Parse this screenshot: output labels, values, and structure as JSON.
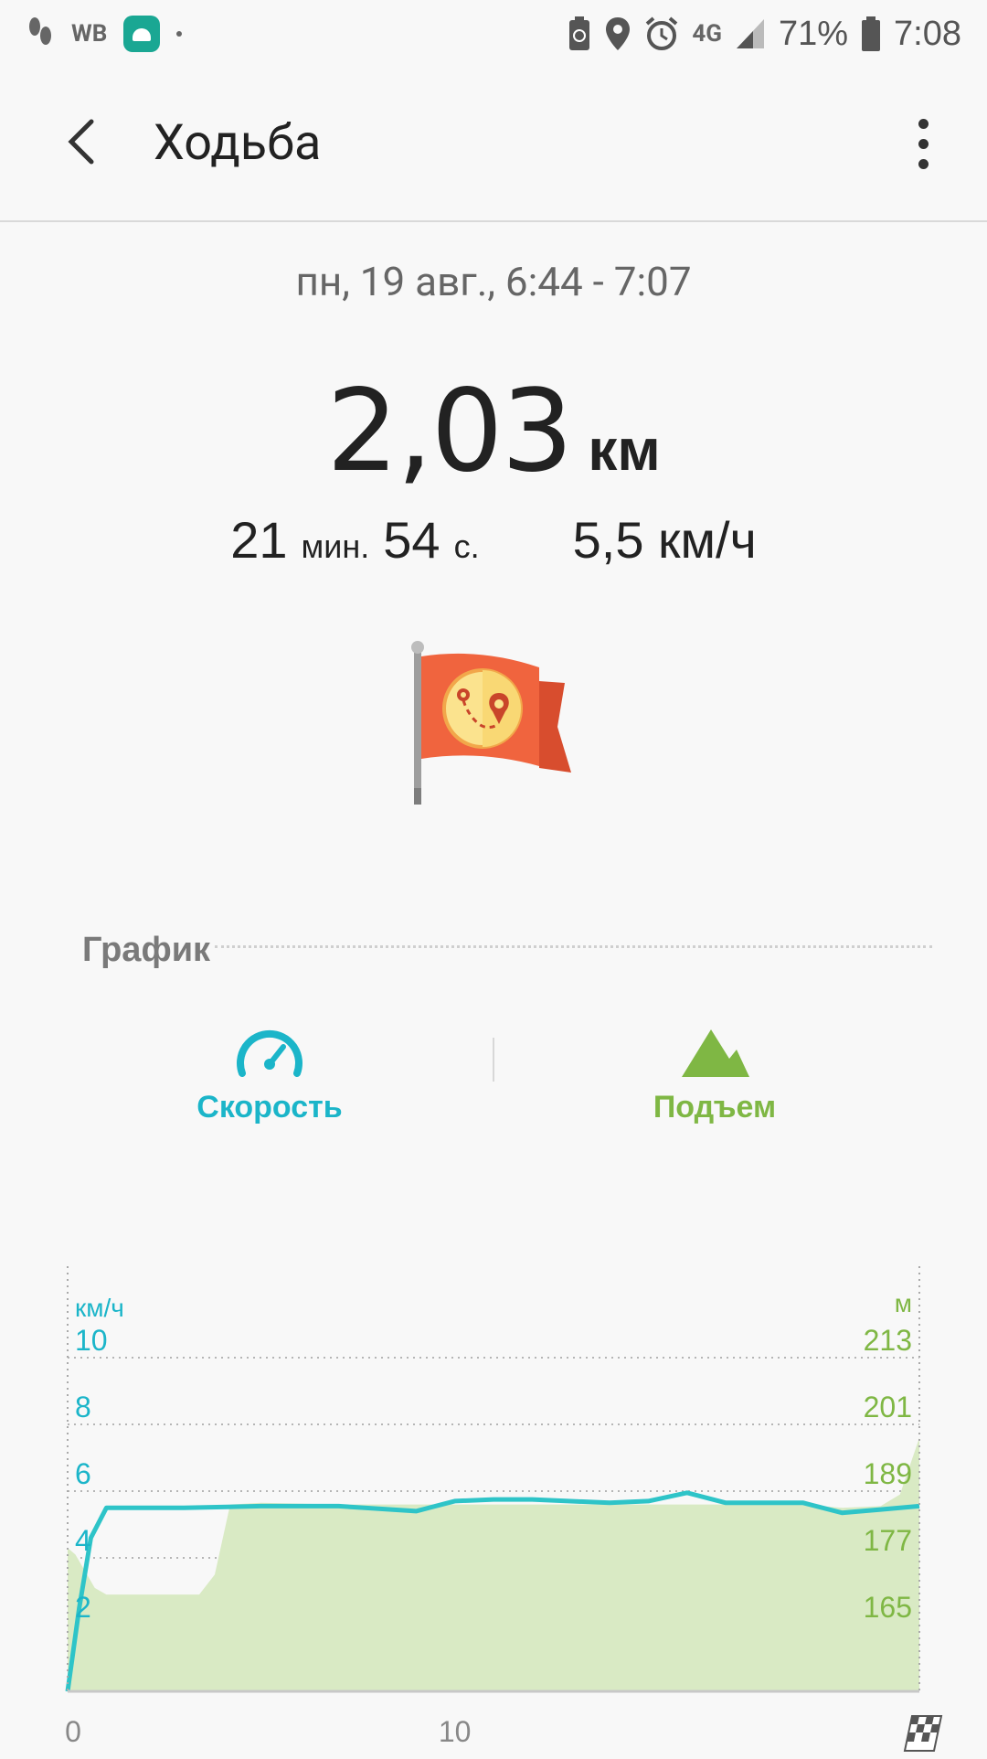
{
  "status_bar": {
    "carrier": "WB",
    "network": "4G",
    "battery": "71%",
    "time": "7:08"
  },
  "header": {
    "title": "Ходьба"
  },
  "summary": {
    "date": "пн, 19 авг., 6:44 - 7:07",
    "distance_value": "2,03",
    "distance_unit": "км",
    "duration_min": "21",
    "min_label": "мин.",
    "duration_sec": "54",
    "sec_label": "с.",
    "speed": "5,5 км/ч"
  },
  "chart_section": {
    "title": "График",
    "tabs": [
      {
        "label": "Скорость",
        "icon": "speedometer-icon",
        "color": "#1bb5c9"
      },
      {
        "label": "Подъем",
        "icon": "mountain-icon",
        "color": "#7fb744"
      }
    ]
  },
  "chart_data": {
    "type": "line",
    "left_axis": {
      "label": "км/ч",
      "ticks": [
        "10",
        "8",
        "6",
        "4",
        "2"
      ],
      "ylim": [
        0,
        11
      ]
    },
    "right_axis": {
      "label": "м",
      "ticks": [
        "213",
        "201",
        "189",
        "177",
        "165"
      ]
    },
    "x_ticks": [
      "0",
      "10"
    ],
    "xlim": [
      0,
      22
    ],
    "series": [
      {
        "type": "line",
        "color": "#2ec4c8",
        "x": [
          0,
          0.3,
          0.6,
          1.0,
          1.5,
          3,
          5,
          7,
          9,
          10,
          11,
          12,
          14,
          15,
          16,
          17,
          18,
          19,
          20,
          21,
          22
        ],
        "y": [
          0,
          2.5,
          4.6,
          5.5,
          5.5,
          5.5,
          5.55,
          5.55,
          5.4,
          5.7,
          5.75,
          5.75,
          5.65,
          5.7,
          5.95,
          5.65,
          5.65,
          5.65,
          5.35,
          5.45,
          5.55
        ]
      },
      {
        "type": "area",
        "color": "#d9eac4",
        "x": [
          0,
          0.2,
          0.7,
          1.0,
          1.5,
          2,
          3,
          3.4,
          3.8,
          4.2,
          5,
          7,
          10,
          15,
          19,
          20,
          21,
          21.5,
          22
        ],
        "y": [
          4.3,
          4.1,
          3.1,
          2.9,
          2.9,
          2.9,
          2.9,
          2.9,
          3.5,
          5.6,
          5.65,
          5.6,
          5.6,
          5.6,
          5.6,
          5.5,
          5.55,
          5.9,
          7.6
        ]
      }
    ]
  }
}
